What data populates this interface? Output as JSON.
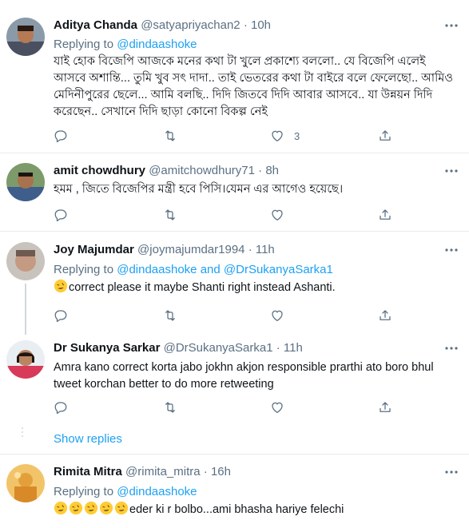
{
  "tweets": [
    {
      "name": "Aditya Chanda",
      "handle": "@satyapriyachan2",
      "time": "10h",
      "replying_prefix": "Replying to",
      "replying_to": [
        "@dindaashoke"
      ],
      "text": "যাই হোক বিজেপি আজকে মনের কথা টা খুলে প্রকাশ্যে বললো.. যে বিজেপি এলেই আসবে অশান্তি... তুমি খুব সৎ দাদা.. তাই ভেতরের কথা টা বাইরে বলে ফেলেছো.. আমিও মেদিনীপুরের ছেলে... আমি বলছি.. দিদি জিতবে দিদি আবার আসবে.. যা উন্নয়ন দিদি করেছেন.. সেখানে দিদি ছাড়া কোনো বিকল্প নেই",
      "like_count": "3"
    },
    {
      "name": "amit chowdhury",
      "handle": "@amitchowdhury71",
      "time": "8h",
      "text": "হমম , জিতে বিজেপির মন্ত্রী হবে পিসি।যেমন এর আগেও হয়েছে।",
      "like_count": ""
    },
    {
      "name": "Joy Majumdar",
      "handle": "@joymajumdar1994",
      "time": "11h",
      "replying_prefix": "Replying to",
      "replying_to": [
        "@dindaashoke",
        "and",
        "@DrSukanyaSarka1"
      ],
      "emoji": "rofl",
      "text": "correct please it maybe Shanti right instead Ashanti.",
      "like_count": ""
    },
    {
      "name": "Dr Sukanya Sarkar",
      "handle": "@DrSukanyaSarka1",
      "time": "11h",
      "text": "Amra kano correct korta jabo jokhn akjon responsible prarthi ato boro bhul tweet korchan better to do more retweeting",
      "like_count": ""
    },
    {
      "name": "Rimita Mitra",
      "handle": "@rimita_mitra",
      "time": "16h",
      "replying_prefix": "Replying to",
      "replying_to": [
        "@dindaashoke"
      ],
      "emoji_count": 5,
      "text": "eder ki r bolbo...ami bhasha hariye felechi"
    }
  ],
  "show_replies": "Show replies",
  "separator": "·",
  "colors": {
    "link": "#1da1f2",
    "secondary": "#5b7083",
    "primary_text": "#0f1419",
    "border": "#e6ecf0"
  },
  "icons": [
    "reply-icon",
    "retweet-icon",
    "like-icon",
    "share-icon",
    "more-icon",
    "rofl-emoji"
  ]
}
